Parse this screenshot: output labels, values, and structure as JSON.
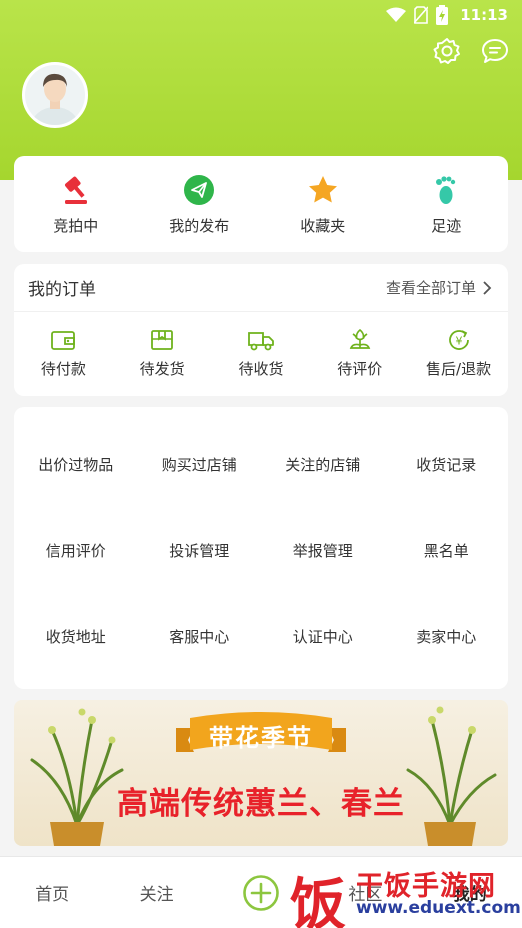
{
  "status_bar": {
    "time": "11:13"
  },
  "header": {
    "settings_icon": "gear-icon",
    "message_icon": "chat-bubble-icon"
  },
  "quick_actions": [
    {
      "label": "竞拍中",
      "icon": "gavel-icon",
      "color": "#e8303a"
    },
    {
      "label": "我的发布",
      "icon": "paper-plane-icon",
      "color": "#2fb54a"
    },
    {
      "label": "收藏夹",
      "icon": "star-icon",
      "color": "#f5a623"
    },
    {
      "label": "足迹",
      "icon": "footprint-icon",
      "color": "#35c8a8"
    }
  ],
  "orders": {
    "title": "我的订单",
    "view_all": "查看全部订单",
    "items": [
      {
        "label": "待付款",
        "icon": "wallet-icon"
      },
      {
        "label": "待发货",
        "icon": "package-icon"
      },
      {
        "label": "待收货",
        "icon": "truck-icon"
      },
      {
        "label": "待评价",
        "icon": "flower-icon"
      },
      {
        "label": "售后/退款",
        "icon": "refund-icon"
      }
    ]
  },
  "services": [
    "出价过物品",
    "购买过店铺",
    "关注的店铺",
    "收货记录",
    "信用评价",
    "投诉管理",
    "举报管理",
    "黑名单",
    "收货地址",
    "客服中心",
    "认证中心",
    "卖家中心"
  ],
  "banner": {
    "ribbon": "带花季节",
    "headline": "高端传统蕙兰、春兰"
  },
  "tabbar": {
    "home": "首页",
    "follow": "关注",
    "community": "社区",
    "mine": "我的"
  },
  "watermark": {
    "char": "饭",
    "name": "干饭手游网",
    "url": "www.eduext.com"
  },
  "colors": {
    "header_green": "#a5d62e",
    "accent_green": "#8cc63f",
    "icon_gray": "#555555"
  }
}
